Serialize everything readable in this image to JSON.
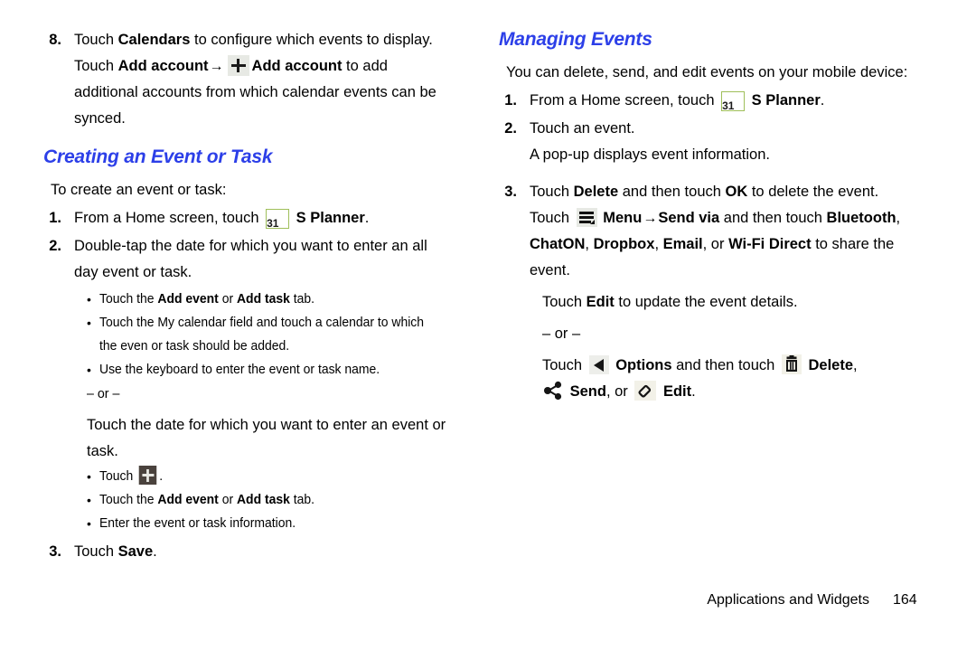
{
  "document": {
    "footer": {
      "section_title": "Applications and Widgets",
      "page_number": "164"
    },
    "accent_color": "#2c3fe8"
  },
  "left_column": {
    "step8": {
      "number": "8.",
      "line1_pre": "Touch ",
      "line1_bold": "Calendars",
      "line1_post": " to configure which events to display.",
      "line2_pre": "Touch ",
      "line2_bold1": "Add account",
      "arrow": "→",
      "icon_name": "plus-icon",
      "line2_bold2": "Add account",
      "line2_post": " to add",
      "line3": "additional accounts from which calendar events can be",
      "line4": "synced."
    },
    "heading": "Creating an Event or Task",
    "intro": "To create an event or task:",
    "step1": {
      "number": "1.",
      "pre": "From a Home screen, touch ",
      "icon_name": "s-planner-calendar-icon",
      "icon_day": "31",
      "bold": "S Planner",
      "post": "."
    },
    "step2": {
      "number": "2.",
      "line1": "Double-tap the date for which you want to enter an all",
      "line2": "day event or task.",
      "bullets": [
        {
          "pre": "Touch the ",
          "bold1": "Add event",
          "mid": " or ",
          "bold2": "Add task",
          "post": " tab."
        },
        {
          "pre": "Touch the My calendar field and touch a calendar to which the even or task should be added.",
          "bold1": "",
          "mid": "",
          "bold2": "",
          "post": ""
        },
        {
          "pre": "Use the keyboard to enter the event or task name.",
          "bold1": "",
          "mid": "",
          "bold2": "",
          "post": ""
        }
      ],
      "or_separator": "– or –",
      "alt_line1": "Touch the date for which you want to enter an event or",
      "alt_line2": "task.",
      "alt_bullets": [
        {
          "pre": "Touch ",
          "has_icon": true,
          "icon_name": "plus-icon-dark",
          "post": "."
        },
        {
          "pre": "Touch the ",
          "bold1": "Add event",
          "mid": " or ",
          "bold2": "Add task",
          "post": " tab."
        },
        {
          "pre": "Enter the event or task information.",
          "bold1": "",
          "mid": "",
          "bold2": "",
          "post": ""
        }
      ]
    },
    "step3": {
      "number": "3.",
      "pre": "Touch ",
      "bold": "Save",
      "post": "."
    }
  },
  "right_column": {
    "heading": "Managing Events",
    "intro": "You can delete, send, and edit events on your mobile device:",
    "step1": {
      "number": "1.",
      "pre": "From a Home screen, touch ",
      "icon_name": "s-planner-calendar-icon",
      "icon_day": "31",
      "bold": "S Planner",
      "post": "."
    },
    "step2": {
      "number": "2.",
      "line1": "Touch an event.",
      "line2": "A pop-up displays event information."
    },
    "step3": {
      "number": "3.",
      "l1_pre": "Touch ",
      "l1_bold1": "Delete",
      "l1_mid": " and then touch ",
      "l1_bold2": "OK",
      "l1_post": " to delete the event.",
      "l2_pre": "Touch ",
      "l2_icon_name": "menu-icon",
      "l2_bold_menu": "Menu",
      "l2_arrow": "→",
      "l2_bold_sendvia": "Send via",
      "l2_mid": " and then touch ",
      "l2_bold_bluetooth": "Bluetooth",
      "l2_comma": ",",
      "l3_bold_chaton": "ChatON",
      "l3_bold_dropbox": "Dropbox",
      "l3_bold_email": "Email",
      "l3_or": ", or ",
      "l3_bold_wifi": "Wi-Fi Direct",
      "l3_post": " to share the",
      "l4": "event.",
      "edit_pre": "Touch ",
      "edit_bold": "Edit",
      "edit_post": " to update the event details.",
      "or_separator": "– or –",
      "opt_pre": "Touch ",
      "opt_icon_name": "triangle-left-icon",
      "opt_bold": "Options",
      "opt_mid": " and then touch ",
      "delete_icon_name": "trash-icon",
      "delete_bold": "Delete",
      "delete_comma": ",",
      "send_icon_name": "share-icon",
      "send_bold": "Send",
      "send_or": ", or ",
      "edit_icon_name": "pencil-icon",
      "edit_bold2": "Edit",
      "end_period": "."
    }
  }
}
